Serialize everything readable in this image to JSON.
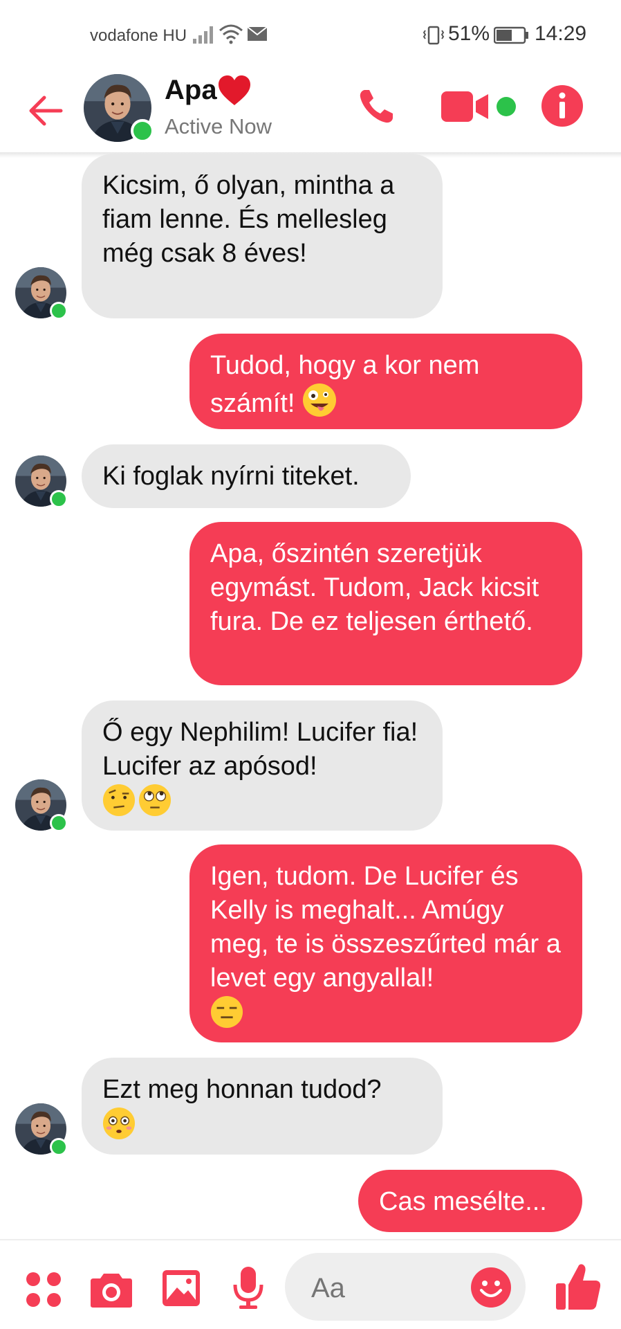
{
  "status_bar": {
    "carrier": "vodafone HU",
    "battery_percent": "51%",
    "time": "14:29"
  },
  "header": {
    "contact_name": "Apa",
    "name_emoji": "heart-emoji",
    "status": "Active Now"
  },
  "messages": [
    {
      "from": "contact",
      "text": "Kicsim, ő olyan, mintha a fiam lenne. És mellesleg még csak 8 éves!"
    },
    {
      "from": "me",
      "text": "Tudod, hogy a kor nem számít!",
      "emoji": "zany-face-emoji"
    },
    {
      "from": "contact",
      "text": "Ki foglak nyírni titeket."
    },
    {
      "from": "me",
      "text": "Apa, őszintén szeretjük egymást. Tudom, Jack kicsit fura. De ez teljesen érthető."
    },
    {
      "from": "contact",
      "text": "Ő egy Nephilim! Lucifer fia! Lucifer az apósod!",
      "emoji": [
        "raised-eyebrow-emoji",
        "eye-roll-emoji"
      ]
    },
    {
      "from": "me",
      "text": "Igen, tudom. De Lucifer és Kelly is meghalt... Amúgy meg, te is összeszűrted már a levet egy angyallal!",
      "emoji": "expressionless-emoji"
    },
    {
      "from": "contact",
      "text": "Ezt meg honnan tudod?",
      "emoji": "flushed-emoji"
    },
    {
      "from": "me",
      "text": "Cas mesélte..."
    }
  ],
  "composer": {
    "placeholder": "Aa"
  },
  "colors": {
    "accent": "#f53d55",
    "incoming_bubble": "#e8e8e8",
    "online": "#2cc24a"
  }
}
